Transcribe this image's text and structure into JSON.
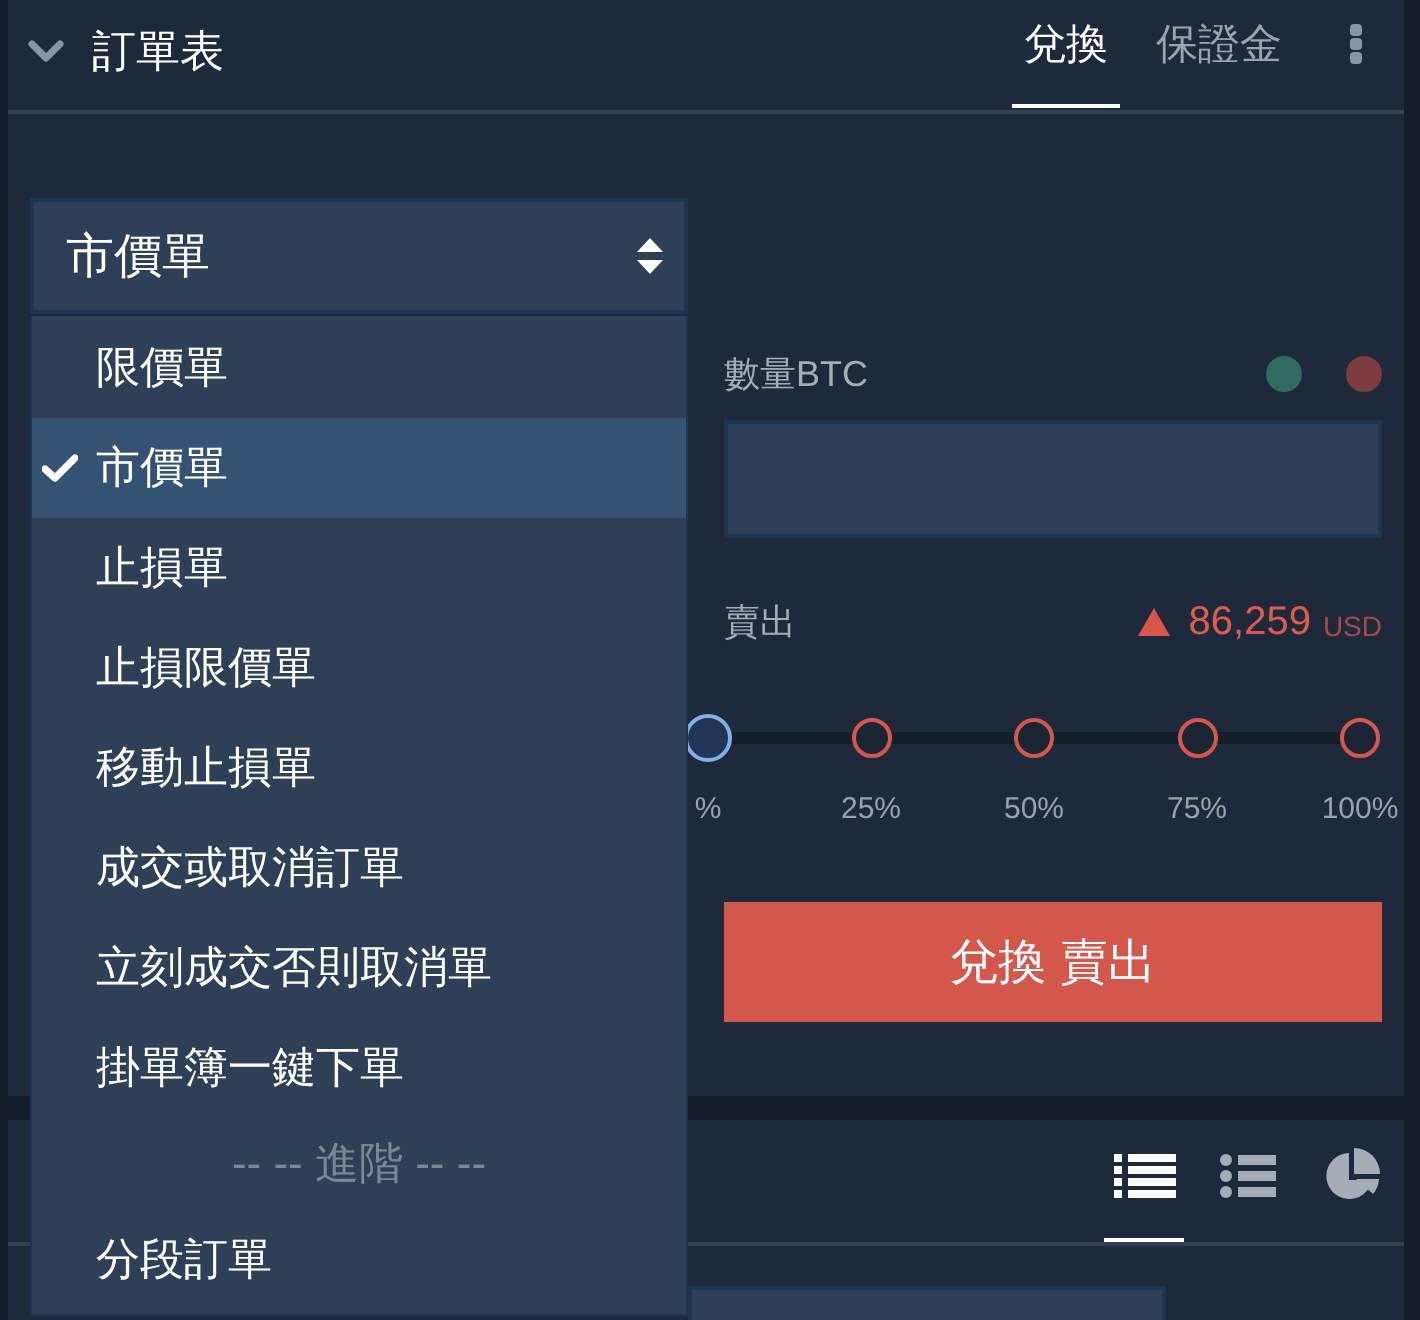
{
  "panel": {
    "title": "訂單表",
    "tabs": [
      {
        "label": "兌換",
        "selected": true
      },
      {
        "label": "保證金",
        "selected": false
      }
    ]
  },
  "order_type": {
    "value": "市價單",
    "expanded": true,
    "options": [
      {
        "kind": "option",
        "label": "限價單",
        "selected": false
      },
      {
        "kind": "option",
        "label": "市價單",
        "selected": true
      },
      {
        "kind": "option",
        "label": "止損單",
        "selected": false
      },
      {
        "kind": "option",
        "label": "止損限價單",
        "selected": false
      },
      {
        "kind": "option",
        "label": "移動止損單",
        "selected": false
      },
      {
        "kind": "option",
        "label": "成交或取消訂單",
        "selected": false
      },
      {
        "kind": "option",
        "label": "立刻成交否則取消單",
        "selected": false
      },
      {
        "kind": "option",
        "label": "掛單簿一鍵下單",
        "selected": false
      },
      {
        "kind": "group",
        "label": "-- -- 進階 -- --"
      },
      {
        "kind": "option",
        "label": "分段訂單",
        "selected": false
      }
    ]
  },
  "quantity": {
    "label": "數量BTC",
    "indicators": [
      {
        "color": "#2e6b5e"
      },
      {
        "color": "#7a3c3c"
      }
    ]
  },
  "price": {
    "label": "賣出",
    "value": "86,259",
    "currency": "USD"
  },
  "amount_slider": {
    "level": 0,
    "marks": [
      "%",
      "25%",
      "50%",
      "75%",
      "100%"
    ]
  },
  "submit_button": {
    "label": "兌換 賣出"
  },
  "bottom_panel": {
    "view_tabs": [
      {
        "kind": "rows",
        "selected": true
      },
      {
        "kind": "bullets",
        "selected": false
      },
      {
        "kind": "pie",
        "selected": false
      }
    ]
  }
}
